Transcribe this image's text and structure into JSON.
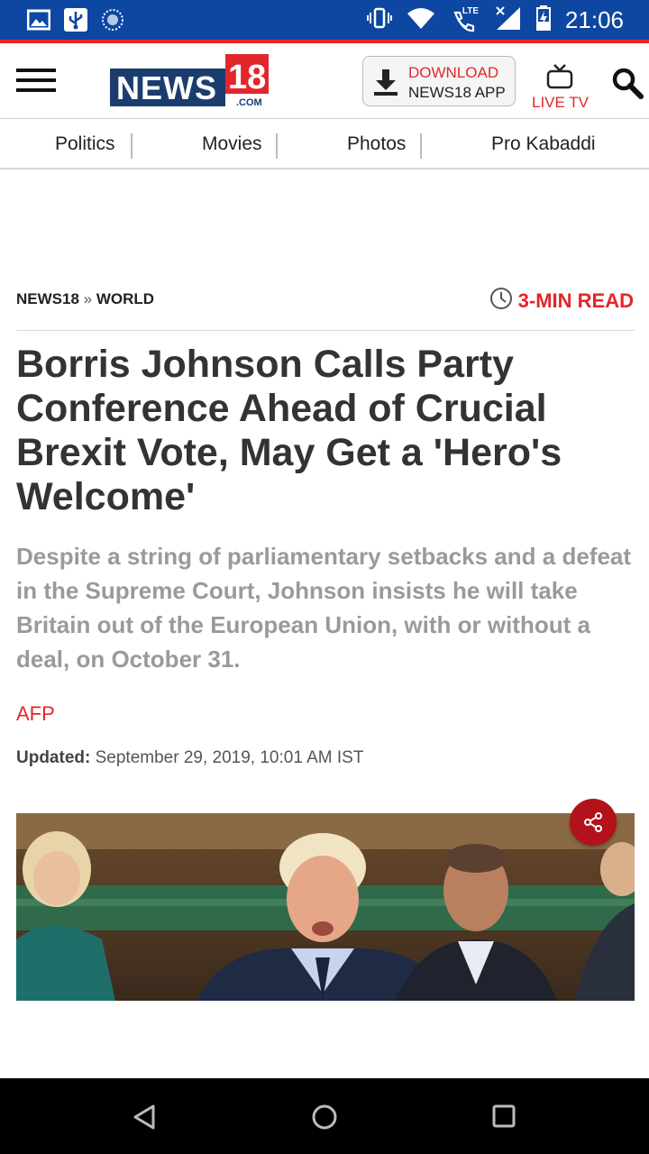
{
  "status_bar": {
    "time": "21:06",
    "left_icons": [
      "image-icon",
      "usb-icon",
      "sync-icon"
    ],
    "right_icons": [
      "vibrate-icon",
      "wifi-icon",
      "lte-call-icon",
      "signal-icon",
      "battery-charging-icon"
    ],
    "lte_label": "LTE",
    "background": "#0d47a1"
  },
  "header": {
    "logo": {
      "text": "NEWS",
      "number": "18",
      "suffix": ".COM"
    },
    "download": {
      "line1": "DOWNLOAD",
      "line2": "NEWS18 APP"
    },
    "live_tv_label": "LIVE TV",
    "accent": "#e3262c"
  },
  "nav": {
    "items": [
      "Politics",
      "Movies",
      "Photos",
      "Pro Kabaddi"
    ]
  },
  "article": {
    "breadcrumb": {
      "home": "NEWS18",
      "separator": "»",
      "section": "WORLD"
    },
    "read_time": "3-MIN READ",
    "headline": "Borris Johnson Calls Party Conference Ahead of Crucial Brexit Vote, May Get a 'Hero's Welcome'",
    "summary": "Despite a string of parliamentary setbacks and a defeat in the Supreme Court, Johnson insists he will take Britain out of the European Union, with or without a deal, on October 31.",
    "source": "AFP",
    "updated_label": "Updated:",
    "updated_value": "September 29, 2019, 10:01 AM IST",
    "share_icon": "share-icon"
  },
  "system_nav": {
    "icons": [
      "back-icon",
      "home-icon",
      "recents-icon"
    ]
  }
}
